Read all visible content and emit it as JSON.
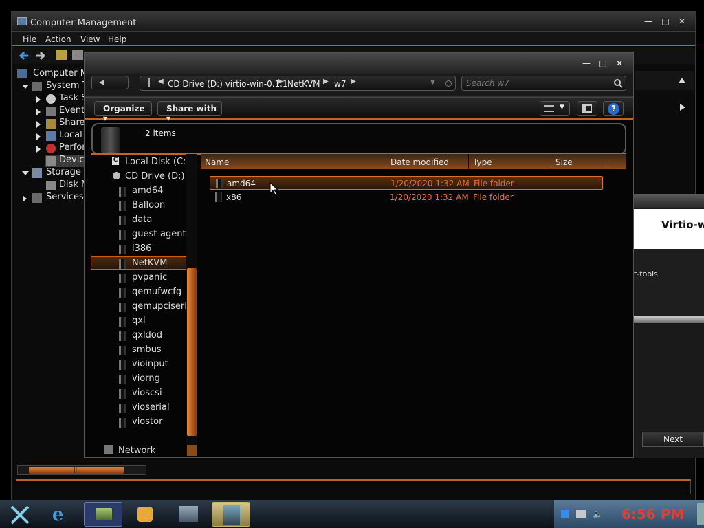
{
  "cm": {
    "title": "Computer Management",
    "menu": [
      "File",
      "Action",
      "View",
      "Help"
    ],
    "tree": {
      "root": "Computer Ma",
      "system_tools": "System T",
      "task": "Task S",
      "event": "Event",
      "shared": "Sharec",
      "local": "Local",
      "perf": "Perfor",
      "device": "Device",
      "storage": "Storage",
      "disk": "Disk M",
      "services": "Services a"
    }
  },
  "explorer": {
    "breadcrumb": [
      "CD Drive (D:) virtio-win-0.1.1",
      "NetKVM",
      "w7"
    ],
    "search_placeholder": "Search w7",
    "organize": "Organize",
    "share_with": "Share with",
    "item_count": "2 items",
    "nav": {
      "local_disk": "Local Disk (C:)",
      "cd_drive": "CD Drive (D:) vi",
      "folders": [
        "amd64",
        "Balloon",
        "data",
        "guest-agent",
        "i386",
        "NetKVM",
        "pvpanic",
        "qemufwcfg",
        "qemupciserial",
        "qxl",
        "qxldod",
        "smbus",
        "vioinput",
        "viorng",
        "vioscsi",
        "vioserial",
        "viostor"
      ],
      "selected": "NetKVM",
      "network": "Network"
    },
    "columns": [
      "Name",
      "Date modified",
      "Type",
      "Size"
    ],
    "files": [
      {
        "name": "amd64",
        "date": "1/20/2020 1:32 AM",
        "type": "File folder"
      },
      {
        "name": "x86",
        "date": "1/20/2020 1:32 AM",
        "type": "File folder"
      }
    ]
  },
  "installer": {
    "title": "Virtio-w",
    "text": "t-tools.",
    "next": "Next"
  },
  "taskbar": {
    "clock": "6:56 PM"
  },
  "colors": {
    "accent": "#c8621e",
    "date_text": "#e0703a"
  }
}
